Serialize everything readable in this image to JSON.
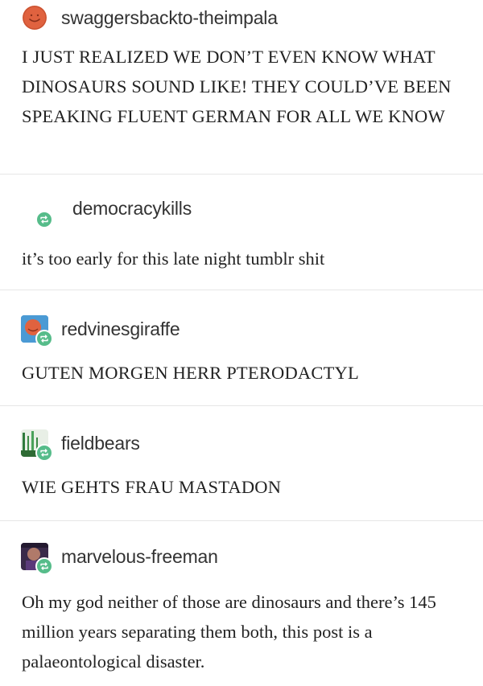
{
  "posts": [
    {
      "username": "swaggersbackto-theimpala",
      "text": "I JUST REALIZED WE DON’T EVEN KNOW WHAT DINOSAURS SOUND LIKE! THEY COULD’VE BEEN SPEAKING FLUENT GERMAN FOR ALL WE KNOW",
      "avatar": "orange-smiley-avatar",
      "reblog": false
    },
    {
      "username": "democracykills",
      "text": "it’s too early for this late night tumblr shit",
      "avatar": "none",
      "reblog": true
    },
    {
      "username": "redvinesgiraffe",
      "text": "GUTEN MORGEN HERR PTERODACTYL",
      "avatar": "blue-orange-avatar",
      "reblog": true
    },
    {
      "username": "fieldbears",
      "text": "WIE GEHTS FRAU MASTADON",
      "avatar": "green-forest-avatar",
      "reblog": true
    },
    {
      "username": "marvelous-freeman",
      "text": "Oh my god neither of those are dinosaurs and there’s 145 million years separating them both, this post is a palaeontological disaster.",
      "avatar": "purple-portrait-avatar",
      "reblog": true
    }
  ],
  "icons": {
    "reblog": "reblog-icon"
  },
  "colors": {
    "reblog_badge": "#56bc8a",
    "divider": "#e6e6e6",
    "text": "#222222"
  }
}
